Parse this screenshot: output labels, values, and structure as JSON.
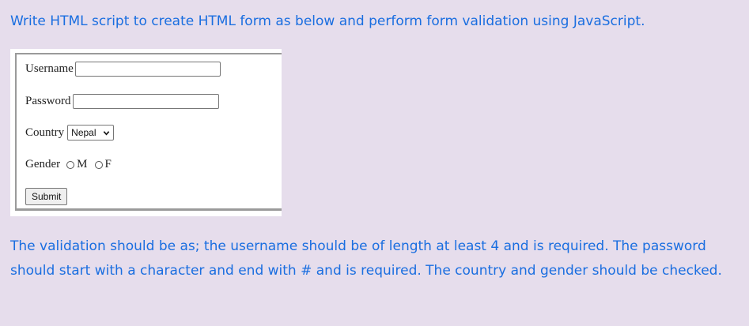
{
  "question": {
    "prompt": "Write HTML script to create HTML form as below and perform form validation using JavaScript.",
    "description": "The validation should be as; the username should be of length at least 4 and is required. The password should start with a character and end with # and is required. The country and gender should be checked."
  },
  "form": {
    "username_label": "Username",
    "username_value": "",
    "password_label": "Password",
    "password_value": "",
    "country_label": "Country",
    "country_selected": "Nepal",
    "gender_label": "Gender",
    "gender_options": [
      "M",
      "F"
    ],
    "submit_label": "Submit"
  },
  "colors": {
    "page_background": "#e6ddec",
    "text_accent": "#1a6ee0"
  },
  "icons": {
    "dropdown": "chevron-down-icon",
    "radio": "radio-unchecked-icon"
  }
}
